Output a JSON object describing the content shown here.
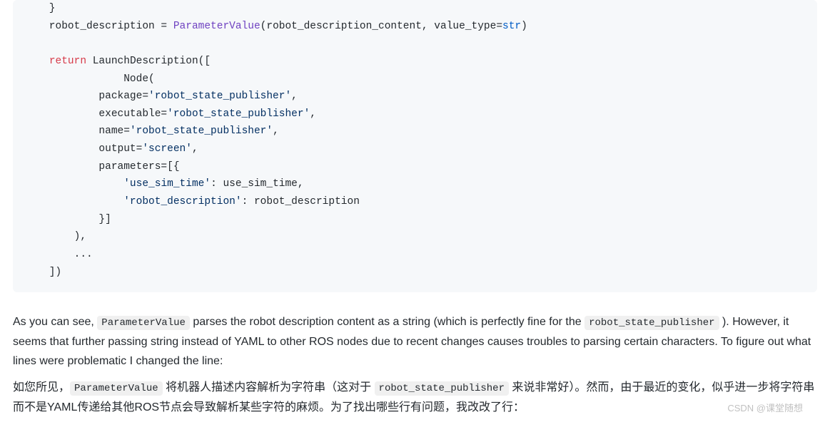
{
  "code": {
    "lines": [
      "    }",
      "    robot_description = <span class='n'>ParameterValue</span>(robot_description_content, value_type=<span class='nb'>str</span>)",
      "",
      "    <span class='k'>return</span> LaunchDescription([",
      "                Node(",
      "            package=<span class='s'>'robot_state_publisher'</span>,",
      "            executable=<span class='s'>'robot_state_publisher'</span>,",
      "            name=<span class='s'>'robot_state_publisher'</span>,",
      "            output=<span class='s'>'screen'</span>,",
      "            parameters=[{",
      "                <span class='s'>'use_sim_time'</span>: use_sim_time,",
      "                <span class='s'>'robot_description'</span>: robot_description",
      "            }]",
      "        ),",
      "        ...",
      "    ])"
    ]
  },
  "prose": {
    "p1_prefix": "As you can see, ",
    "p1_code1": "ParameterValue",
    "p1_mid": " parses the robot description content as a string (which is perfectly fine for the ",
    "p1_code2": "robot_state_publisher",
    "p1_suffix": " ). However, it seems that further passing string instead of YAML to other ROS nodes due to recent changes causes troubles to parsing certain characters. To figure out what lines were problematic I changed the line:",
    "p2_prefix": "如您所见，",
    "p2_code1": "ParameterValue",
    "p2_mid": " 将机器人描述内容解析为字符串（这对于 ",
    "p2_code2": "robot_state_publisher",
    "p2_suffix": " 来说非常好）。然而，由于最近的变化，似乎进一步将字符串而不是YAML传递给其他ROS节点会导致解析某些字符的麻烦。为了找出哪些行有问题，我改改了行："
  },
  "watermark": "CSDN @课堂随想"
}
